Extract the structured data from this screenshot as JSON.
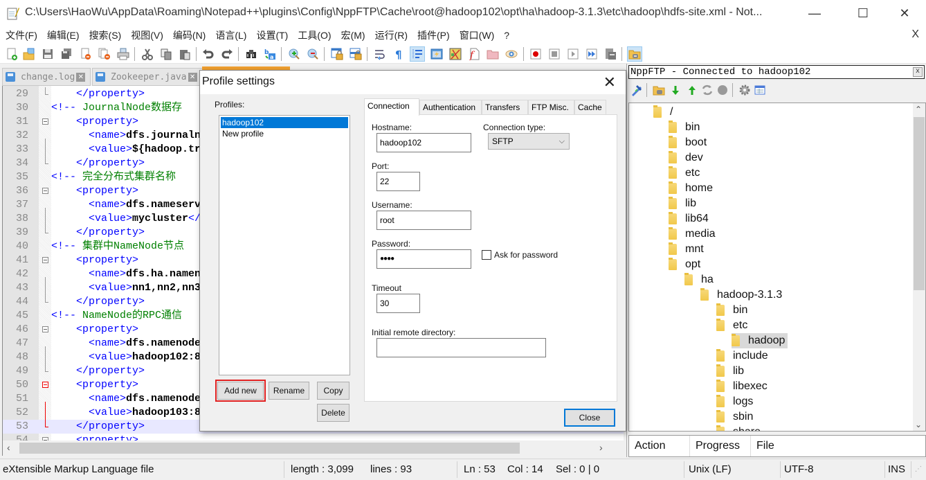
{
  "window": {
    "title": "C:\\Users\\HaoWu\\AppData\\Roaming\\Notepad++\\plugins\\Config\\NppFTP\\Cache\\root@hadoop102\\opt\\ha\\hadoop-3.1.3\\etc\\hadoop\\hdfs-site.xml - Not...",
    "app_icon": "notepad-icon",
    "controls": {
      "minimize": "—",
      "maximize": "☐",
      "close": "✕"
    }
  },
  "menubar": {
    "items": [
      "文件(F)",
      "编辑(E)",
      "搜索(S)",
      "视图(V)",
      "编码(N)",
      "语言(L)",
      "设置(T)",
      "工具(O)",
      "宏(M)",
      "运行(R)",
      "插件(P)",
      "窗口(W)",
      "?"
    ],
    "close_doc": "X"
  },
  "toolbar": {
    "buttons": [
      "new-file-icon",
      "open-file-icon",
      "save-icon",
      "save-all-icon",
      "close-icon",
      "close-all-icon",
      "print-icon",
      "cut-icon",
      "copy-icon",
      "paste-icon",
      "undo-icon",
      "redo-icon",
      "find-icon",
      "replace-icon",
      "zoom-in-icon",
      "zoom-out-icon",
      "sync-vertical-icon",
      "sync-horizontal-icon",
      "word-wrap-icon",
      "show-all-chars-icon",
      "indent-guide-icon",
      "udl-icon",
      "document-map-icon",
      "function-list-icon",
      "folder-as-workspace-icon",
      "monitoring-icon",
      "record-macro-icon",
      "stop-record-icon",
      "playback-macro-icon",
      "run-macro-multiple-icon",
      "save-macro-icon",
      "nppftp-icon"
    ]
  },
  "doc_tabs": [
    {
      "label": "change.log",
      "icon": "save-icon",
      "close": "✕"
    },
    {
      "label": "Zookeeper.java",
      "icon": "save-icon",
      "close": "✕"
    }
  ],
  "editor": {
    "lines": [
      {
        "n": "29",
        "parts": [
          [
            "tag",
            "    </property>"
          ]
        ]
      },
      {
        "n": "30",
        "parts": [
          [
            "tag",
            "<!-- "
          ],
          [
            "cm",
            "JournalNode数据存"
          ]
        ]
      },
      {
        "n": "31",
        "parts": [
          [
            "tag",
            "    <property>"
          ]
        ]
      },
      {
        "n": "32",
        "parts": [
          [
            "tag",
            "      <name>"
          ],
          [
            "bold",
            "dfs.journaln"
          ]
        ]
      },
      {
        "n": "33",
        "parts": [
          [
            "tag",
            "      <value>"
          ],
          [
            "bold",
            "${hadoop.tr"
          ]
        ]
      },
      {
        "n": "34",
        "parts": [
          [
            "tag",
            "    </property>"
          ]
        ]
      },
      {
        "n": "35",
        "parts": [
          [
            "tag",
            "<!-- "
          ],
          [
            "cm",
            "完全分布式集群名称"
          ]
        ]
      },
      {
        "n": "36",
        "parts": [
          [
            "tag",
            "    <property>"
          ]
        ]
      },
      {
        "n": "37",
        "parts": [
          [
            "tag",
            "      <name>"
          ],
          [
            "bold",
            "dfs.nameserv"
          ]
        ]
      },
      {
        "n": "38",
        "parts": [
          [
            "tag",
            "      <value>"
          ],
          [
            "bold",
            "mycluster"
          ],
          [
            "tag",
            "</"
          ]
        ]
      },
      {
        "n": "39",
        "parts": [
          [
            "tag",
            "    </property>"
          ]
        ]
      },
      {
        "n": "40",
        "parts": [
          [
            "tag",
            "<!-- "
          ],
          [
            "cm",
            "集群中NameNode节点"
          ]
        ]
      },
      {
        "n": "41",
        "parts": [
          [
            "tag",
            "    <property>"
          ]
        ]
      },
      {
        "n": "42",
        "parts": [
          [
            "tag",
            "      <name>"
          ],
          [
            "bold",
            "dfs.ha.namen"
          ]
        ]
      },
      {
        "n": "43",
        "parts": [
          [
            "tag",
            "      <value>"
          ],
          [
            "bold",
            "nn1,nn2,nn3"
          ]
        ]
      },
      {
        "n": "44",
        "parts": [
          [
            "tag",
            "    </property>"
          ]
        ]
      },
      {
        "n": "45",
        "parts": [
          [
            "tag",
            "<!-- "
          ],
          [
            "cm",
            "NameNode的RPC通信"
          ]
        ]
      },
      {
        "n": "46",
        "parts": [
          [
            "tag",
            "    <property>"
          ]
        ]
      },
      {
        "n": "47",
        "parts": [
          [
            "tag",
            "      <name>"
          ],
          [
            "bold",
            "dfs.namenode"
          ]
        ]
      },
      {
        "n": "48",
        "parts": [
          [
            "tag",
            "      <value>"
          ],
          [
            "bold",
            "hadoop102:8"
          ]
        ]
      },
      {
        "n": "49",
        "parts": [
          [
            "tag",
            "    </property>"
          ]
        ]
      },
      {
        "n": "50",
        "parts": [
          [
            "tag",
            "    <property>"
          ]
        ]
      },
      {
        "n": "51",
        "parts": [
          [
            "tag",
            "      <name>"
          ],
          [
            "bold",
            "dfs.namenode"
          ]
        ]
      },
      {
        "n": "52",
        "parts": [
          [
            "tag",
            "      <value>"
          ],
          [
            "bold",
            "hadoop103:8"
          ]
        ]
      },
      {
        "n": "53",
        "parts": [
          [
            "tag",
            "    </property>"
          ]
        ]
      },
      {
        "n": "54",
        "parts": [
          [
            "tag",
            "    <property>"
          ]
        ]
      }
    ],
    "current_line": "53"
  },
  "statusbar": {
    "file_type": "eXtensible Markup Language file",
    "length": "length : 3,099",
    "lines": "lines : 93",
    "ln": "Ln : 53",
    "col": "Col : 14",
    "sel": "Sel : 0 | 0",
    "eol": "Unix (LF)",
    "encoding": "UTF-8",
    "mode": "INS"
  },
  "ftp_panel": {
    "caption": "NppFTP - Connected to hadoop102",
    "close": "x",
    "toolbar": [
      "connect-icon",
      "open-directory-icon",
      "download-icon",
      "upload-icon",
      "refresh-icon",
      "abort-icon",
      "settings-icon",
      "message-window-icon"
    ],
    "tree": [
      {
        "label": "/",
        "depth": 0
      },
      {
        "label": "bin",
        "depth": 1
      },
      {
        "label": "boot",
        "depth": 1
      },
      {
        "label": "dev",
        "depth": 1
      },
      {
        "label": "etc",
        "depth": 1
      },
      {
        "label": "home",
        "depth": 1
      },
      {
        "label": "lib",
        "depth": 1
      },
      {
        "label": "lib64",
        "depth": 1
      },
      {
        "label": "media",
        "depth": 1
      },
      {
        "label": "mnt",
        "depth": 1
      },
      {
        "label": "opt",
        "depth": 1
      },
      {
        "label": "ha",
        "depth": 2
      },
      {
        "label": "hadoop-3.1.3",
        "depth": 3
      },
      {
        "label": "bin",
        "depth": 4
      },
      {
        "label": "etc",
        "depth": 4
      },
      {
        "label": "hadoop",
        "depth": 5,
        "selected": true
      },
      {
        "label": "include",
        "depth": 4
      },
      {
        "label": "lib",
        "depth": 4
      },
      {
        "label": "libexec",
        "depth": 4
      },
      {
        "label": "logs",
        "depth": 4
      },
      {
        "label": "sbin",
        "depth": 4
      },
      {
        "label": "share",
        "depth": 4
      }
    ],
    "queue_columns": [
      "Action",
      "Progress",
      "File"
    ]
  },
  "dialog": {
    "title": "Profile settings",
    "close": "✕",
    "profiles_label": "Profiles:",
    "profiles": [
      "hadoop102",
      "New profile"
    ],
    "selected_profile": "hadoop102",
    "buttons": {
      "add_new": "Add new",
      "rename": "Rename",
      "copy": "Copy",
      "delete": "Delete",
      "close": "Close"
    },
    "tabs": [
      "Connection",
      "Authentication",
      "Transfers",
      "FTP Misc.",
      "Cache"
    ],
    "active_tab": "Connection",
    "fields": {
      "hostname_label": "Hostname:",
      "hostname": "hadoop102",
      "connection_type_label": "Connection type:",
      "connection_type": "SFTP",
      "port_label": "Port:",
      "port": "22",
      "username_label": "Username:",
      "username": "root",
      "password_label": "Password:",
      "password": "●●●●",
      "ask_password_label": "Ask for password",
      "ask_password_checked": false,
      "timeout_label": "Timeout",
      "timeout": "30",
      "initial_dir_label": "Initial remote directory:",
      "initial_dir": ""
    }
  }
}
